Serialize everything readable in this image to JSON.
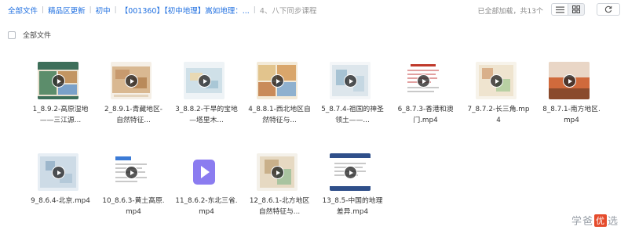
{
  "breadcrumb": {
    "items": [
      "全部文件",
      "精品区更新",
      "初中",
      "【001360】【初中地理】嵩如地理：...",
      "4、八下同步课程"
    ]
  },
  "status": "已全部加载，共13个",
  "toolbar": {
    "list_icon": "list-icon",
    "grid_icon": "grid-icon",
    "refresh_icon": "refresh-icon"
  },
  "select_all_label": "全部文件",
  "files": [
    {
      "name": "1_8.9.2-高原湿地——三江源..."
    },
    {
      "name": "2_8.9.1-青藏地区-自然特征..."
    },
    {
      "name": "3_8.8.2-干旱的宝地—塔里木..."
    },
    {
      "name": "4_8.8.1-西北地区自然特征与..."
    },
    {
      "name": "5_8.7.4-祖国的神圣领土——..."
    },
    {
      "name": "6_8.7.3-香港和澳门.mp4"
    },
    {
      "name": "7_8.7.2-长三角.mp4"
    },
    {
      "name": "8_8.7.1-南方地区.mp4"
    },
    {
      "name": "9_8.6.4-北京.mp4"
    },
    {
      "name": "10_8.6.3-黄土高原.mp4"
    },
    {
      "name": "11_8.6.2-东北三省.mp4"
    },
    {
      "name": "12_8.6.1-北方地区自然特征与..."
    },
    {
      "name": "13_8.5-中国的地理差异.mp4"
    }
  ],
  "watermark": {
    "pre": "学爸",
    "badge": "优",
    "post": "选"
  },
  "colors": {
    "link": "#1f6fe0",
    "video_icon": "#8b7cf0"
  }
}
